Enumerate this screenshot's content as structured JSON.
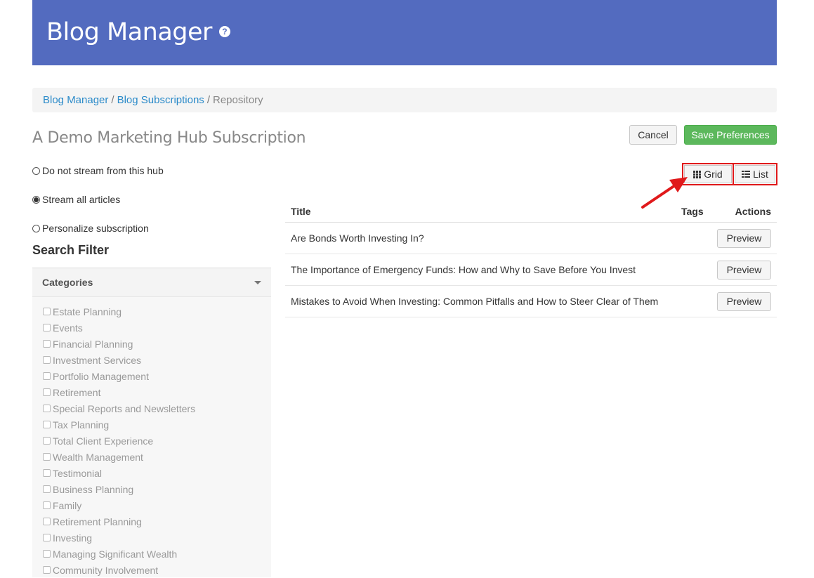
{
  "header": {
    "title": "Blog Manager",
    "help_icon": "question-circle-icon",
    "color": "#536bbf"
  },
  "breadcrumb": [
    {
      "label": "Blog Manager"
    },
    {
      "label": "Blog Subscriptions"
    },
    {
      "label": "Repository"
    }
  ],
  "subscription": {
    "title": "A Demo Marketing Hub Subscription"
  },
  "actions": {
    "cancel_label": "Cancel",
    "save_label": "Save Preferences",
    "save_color": "#5cb85c"
  },
  "view_toggle": {
    "grid_label": "Grid",
    "list_label": "List",
    "highlight_color": "#e0191b"
  },
  "stream_options": [
    {
      "label": "Do not stream from this hub",
      "checked": false
    },
    {
      "label": "Stream all articles",
      "checked": true
    },
    {
      "label": "Personalize subscription",
      "checked": false
    }
  ],
  "search_filter": {
    "title": "Search Filter",
    "categories_label": "Categories",
    "categories": [
      "Estate Planning",
      "Events",
      "Financial Planning",
      "Investment Services",
      "Portfolio Management",
      "Retirement",
      "Special Reports and Newsletters",
      "Tax Planning",
      "Total Client Experience",
      "Wealth Management",
      "Testimonial",
      "Business Planning",
      "Family",
      "Retirement Planning",
      "Investing",
      "Managing Significant Wealth",
      "Community Involvement"
    ]
  },
  "table": {
    "headers": {
      "title": "Title",
      "tags": "Tags",
      "actions": "Actions"
    },
    "rows": [
      {
        "title": "Are Bonds Worth Investing In?",
        "action": "Preview"
      },
      {
        "title": "The Importance of Emergency Funds: How and Why to Save Before You Invest",
        "action": "Preview"
      },
      {
        "title": "Mistakes to Avoid When Investing: Common Pitfalls and How to Steer Clear of Them",
        "action": "Preview"
      }
    ]
  }
}
